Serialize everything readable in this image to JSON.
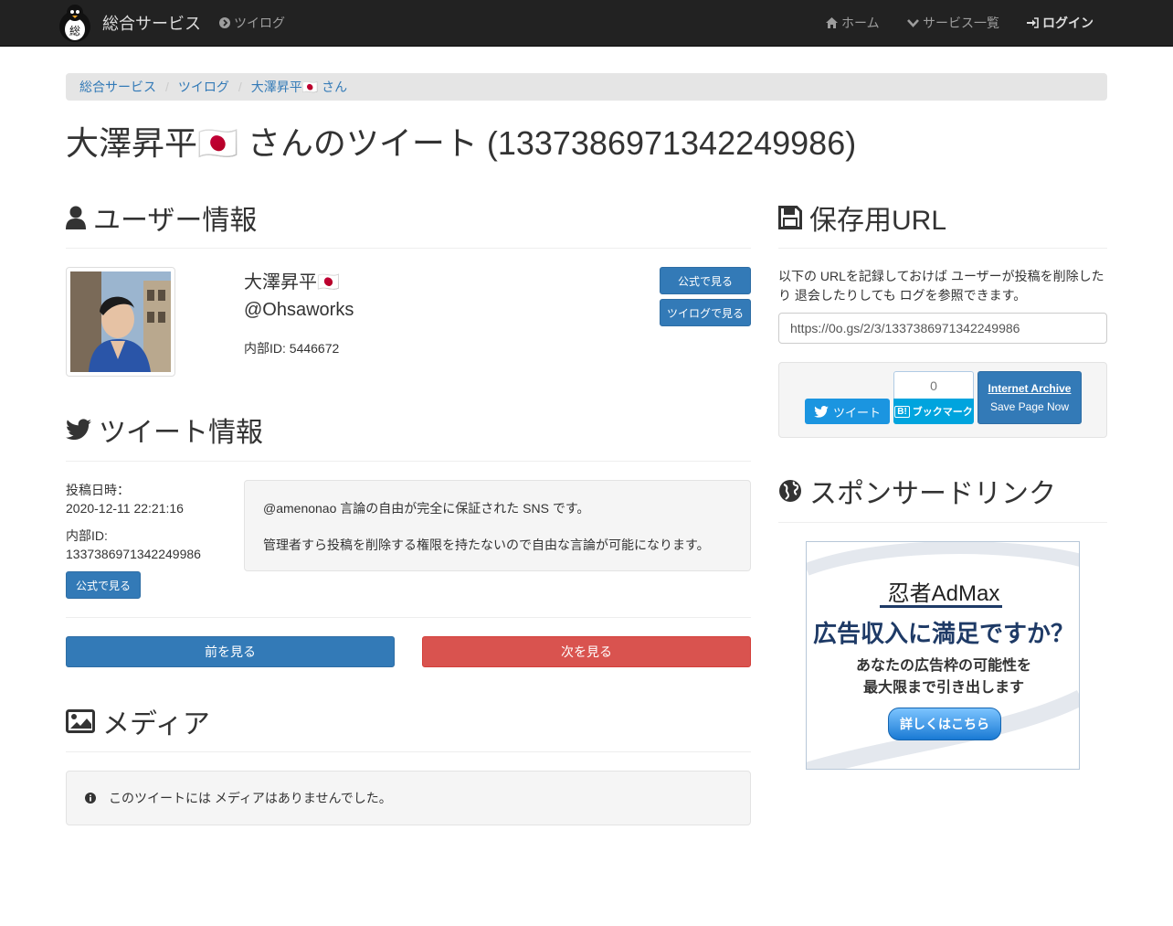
{
  "navbar": {
    "brand": "総合サービス",
    "twilog": "ツイログ",
    "home": "ホーム",
    "services": "サービス一覧",
    "login": "ログイン"
  },
  "breadcrumb": [
    "総合サービス",
    "ツイログ",
    "大澤昇平🇯🇵 さん"
  ],
  "page_title": "大澤昇平🇯🇵 さんのツイート (1337386971342249986)",
  "user_section": {
    "heading": "ユーザー情報",
    "name": "大澤昇平🇯🇵",
    "handle": "@Ohsaworks",
    "internal_id": "内部ID: 5446672",
    "btn_official": "公式で見る",
    "btn_twilog": "ツイログで見る"
  },
  "tweet_section": {
    "heading": "ツイート情報",
    "posted_label": "投稿日時：",
    "posted_at": "2020-12-11 22:21:16",
    "id_label": "内部ID:",
    "id_value": "1337386971342249986",
    "btn_official": "公式で見る",
    "text_line1": "@amenonao 言論の自由が完全に保証された SNS です。",
    "text_line2": "管理者すら投稿を削除する権限を持たないので自由な言論が可能になります。"
  },
  "pager": {
    "prev": "前を見る",
    "next": "次を見る"
  },
  "media_section": {
    "heading": "メディア",
    "empty": "このツイートには メディアはありませんでした。"
  },
  "save_section": {
    "heading": "保存用URL",
    "description": "以下の URLを記録しておけば ユーザーが投稿を削除したり 退会したりしても ログを参照できます。",
    "url": "https://0o.gs/2/3/1337386971342249986",
    "tweet_btn": "ツイート",
    "hatena_count": "0",
    "hatena_btn": "ブックマーク",
    "hatena_b": "B!",
    "ia_title": "Internet Archive",
    "ia_sub": "Save Page Now"
  },
  "sponsor_section": {
    "heading": "スポンサードリンク",
    "ad_logo": "忍者AdMax",
    "ad_headline": "広告収入に満足ですか？",
    "ad_line1": "あなたの広告枠の可能性を",
    "ad_line2": "最大限まで引き出します",
    "ad_button": "詳しくはこちら"
  },
  "colors": {
    "navbar_bg": "#222222",
    "primary": "#337ab7",
    "danger": "#d9534f",
    "twitter": "#1b95e0",
    "hatena": "#00a4de"
  }
}
